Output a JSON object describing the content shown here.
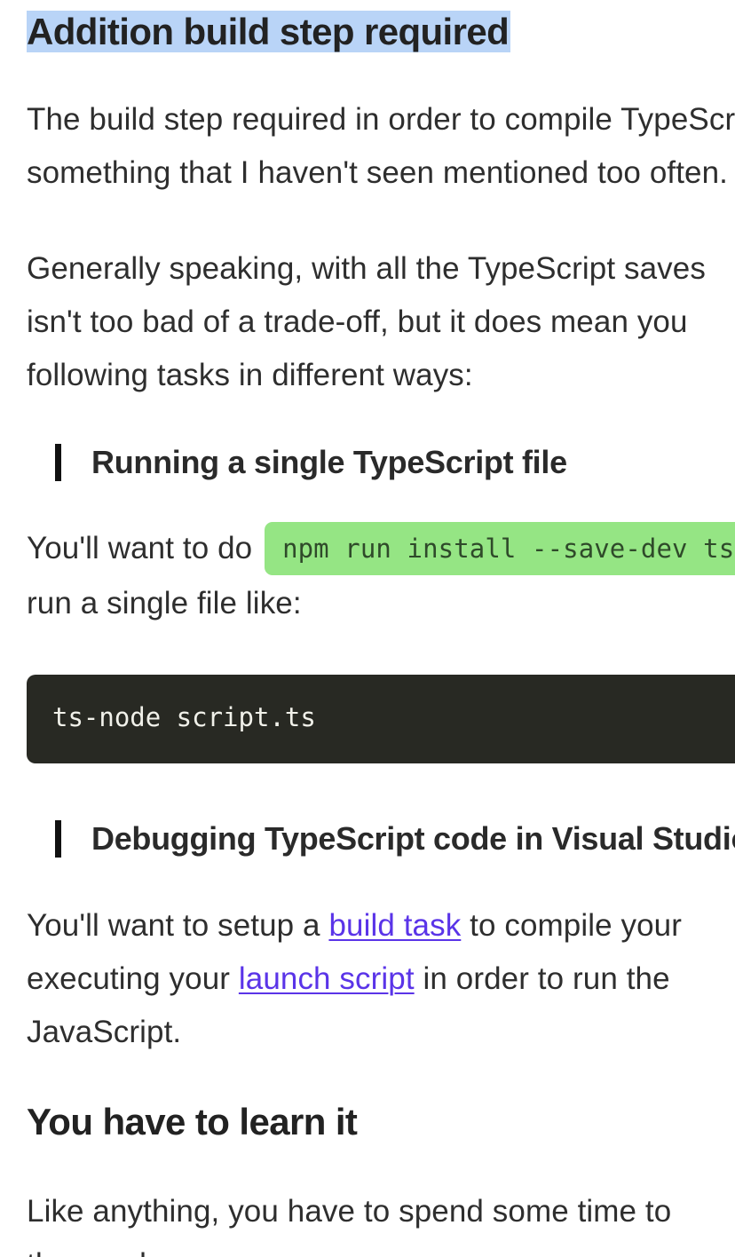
{
  "article": {
    "heading_build": "Addition build step required",
    "para_build_1": "The build step required in order to compile TypeScript",
    "para_build_2": "something that I haven't seen mentioned too often.",
    "para_general_1": "Generally speaking, with all the TypeScript saves",
    "para_general_2": "isn't too bad of a trade-off, but it does mean you",
    "para_general_3": "following tasks in different ways:",
    "quote_running": "Running a single TypeScript file",
    "running_text_before": "You'll want to do",
    "running_code": "npm run install --save-dev ts-node",
    "running_text_line2": "run a single file like:",
    "code_block": "ts-node script.ts",
    "quote_debugging": "Debugging TypeScript code in Visual Studio Code",
    "debug_text_1_before": "You'll want to setup a",
    "debug_link_build_task": "build task",
    "debug_text_1_after": "to compile your",
    "debug_text_2_before": "executing your",
    "debug_link_launch_script": "launch script",
    "debug_text_2_after": "in order to run the",
    "debug_text_3": "JavaScript.",
    "heading_learn": "You have to learn it",
    "para_learn_1": "Like anything, you have to spend some time to",
    "para_learn_2": "the number"
  },
  "colors": {
    "selection_highlight": "#b9d4f7",
    "inline_code_bg": "#95e584",
    "code_block_bg": "#282923",
    "link": "#5a34e8"
  }
}
